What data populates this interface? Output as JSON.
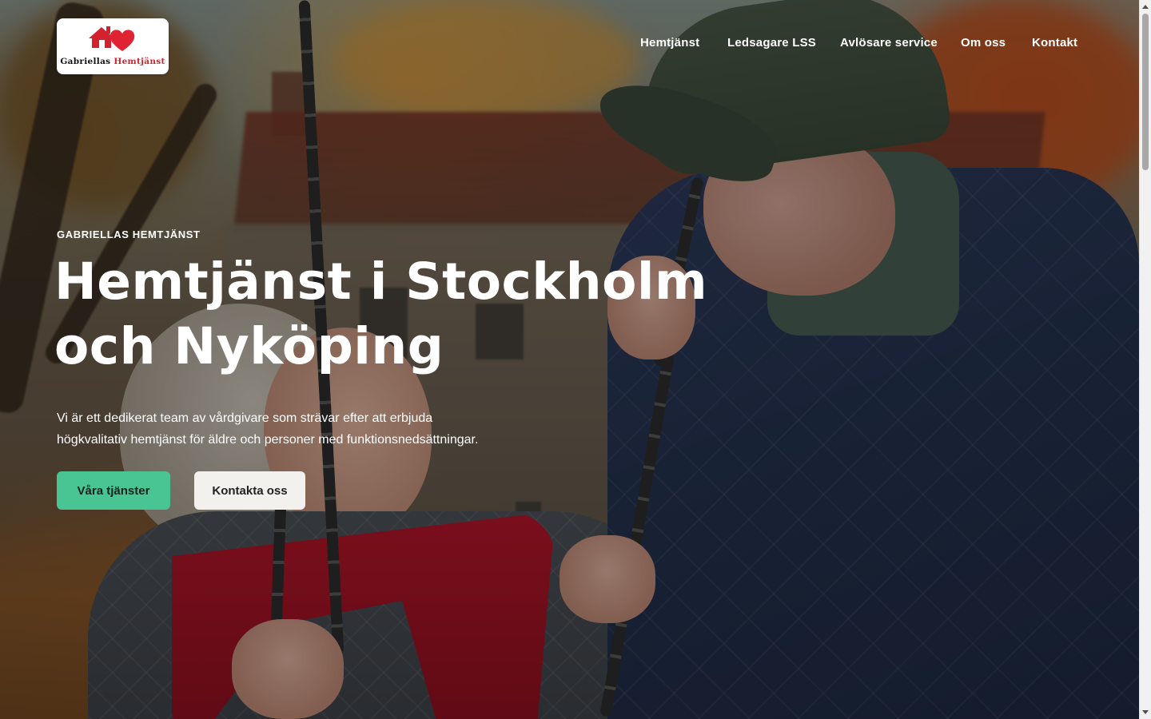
{
  "brand": {
    "logo_text_main": "Gabriellas",
    "logo_text_accent": "Hemtjänst",
    "accent_color": "#d3222d",
    "logo_icon": "house-heart-icon"
  },
  "nav": {
    "items": [
      {
        "label": "Hemtjänst"
      },
      {
        "label": "Ledsagare LSS"
      },
      {
        "label": "Avlösare service"
      },
      {
        "label": "Om oss"
      },
      {
        "label": "Kontakt"
      }
    ]
  },
  "hero": {
    "eyebrow": "GABRIELLAS HEMTJÄNST",
    "title_line1": "Hemtjänst i Stockholm",
    "title_line2": "och Nyköping",
    "lead_line1": "Vi är ett dedikerat team av vårdgivare som strävar efter att erbjuda",
    "lead_line2": "högkvalitativ hemtjänst för äldre och personer med funktionsnedsättningar.",
    "primary_button": "Våra tjänster",
    "secondary_button": "Kontakta oss",
    "primary_color": "#49c493",
    "secondary_color": "#f3f1ee"
  }
}
